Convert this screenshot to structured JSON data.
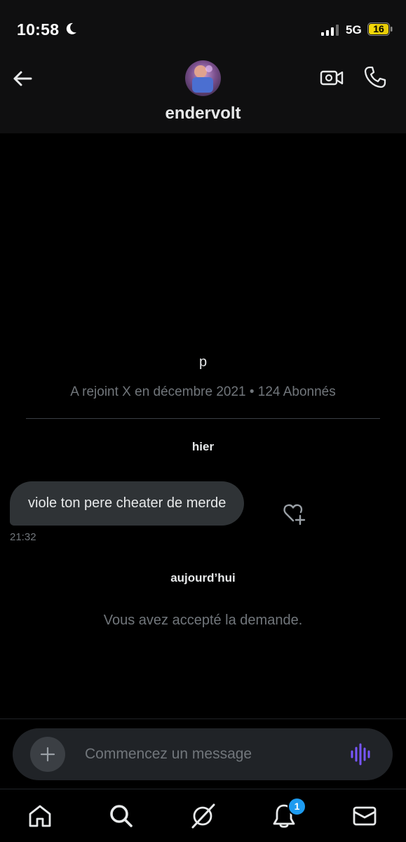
{
  "status_bar": {
    "time": "10:58",
    "network": "5G",
    "battery": "16",
    "icons": [
      "moon-icon",
      "signal-icon",
      "battery-icon"
    ]
  },
  "header": {
    "username": "endervolt",
    "icons": [
      "back-arrow-icon",
      "avatar",
      "video-camera-icon",
      "phone-icon"
    ]
  },
  "profile": {
    "name": "p",
    "meta": "A rejoint X en décembre 2021 • 124 Abonnés"
  },
  "conversation": {
    "day_yesterday": "hier",
    "messages": [
      {
        "text": "viole ton pere cheater de merde",
        "time": "21:32"
      }
    ],
    "day_today": "aujourd’hui",
    "system_message": "Vous avez accepté la demande."
  },
  "composer": {
    "placeholder": "Commencez un message",
    "icons": [
      "plus-icon",
      "voice-waveform-icon"
    ]
  },
  "nav": {
    "items": [
      "home-icon",
      "search-icon",
      "grok-icon",
      "bell-icon",
      "mail-icon"
    ],
    "notification_count": "1"
  },
  "colors": {
    "background": "#000000",
    "header_bg": "#0f0f10",
    "bubble": "#2f3336",
    "muted_text": "#71767b",
    "accent_blue": "#1d9bf0",
    "voice_purple": "#7856ff",
    "battery_yellow": "#f5d90a"
  }
}
